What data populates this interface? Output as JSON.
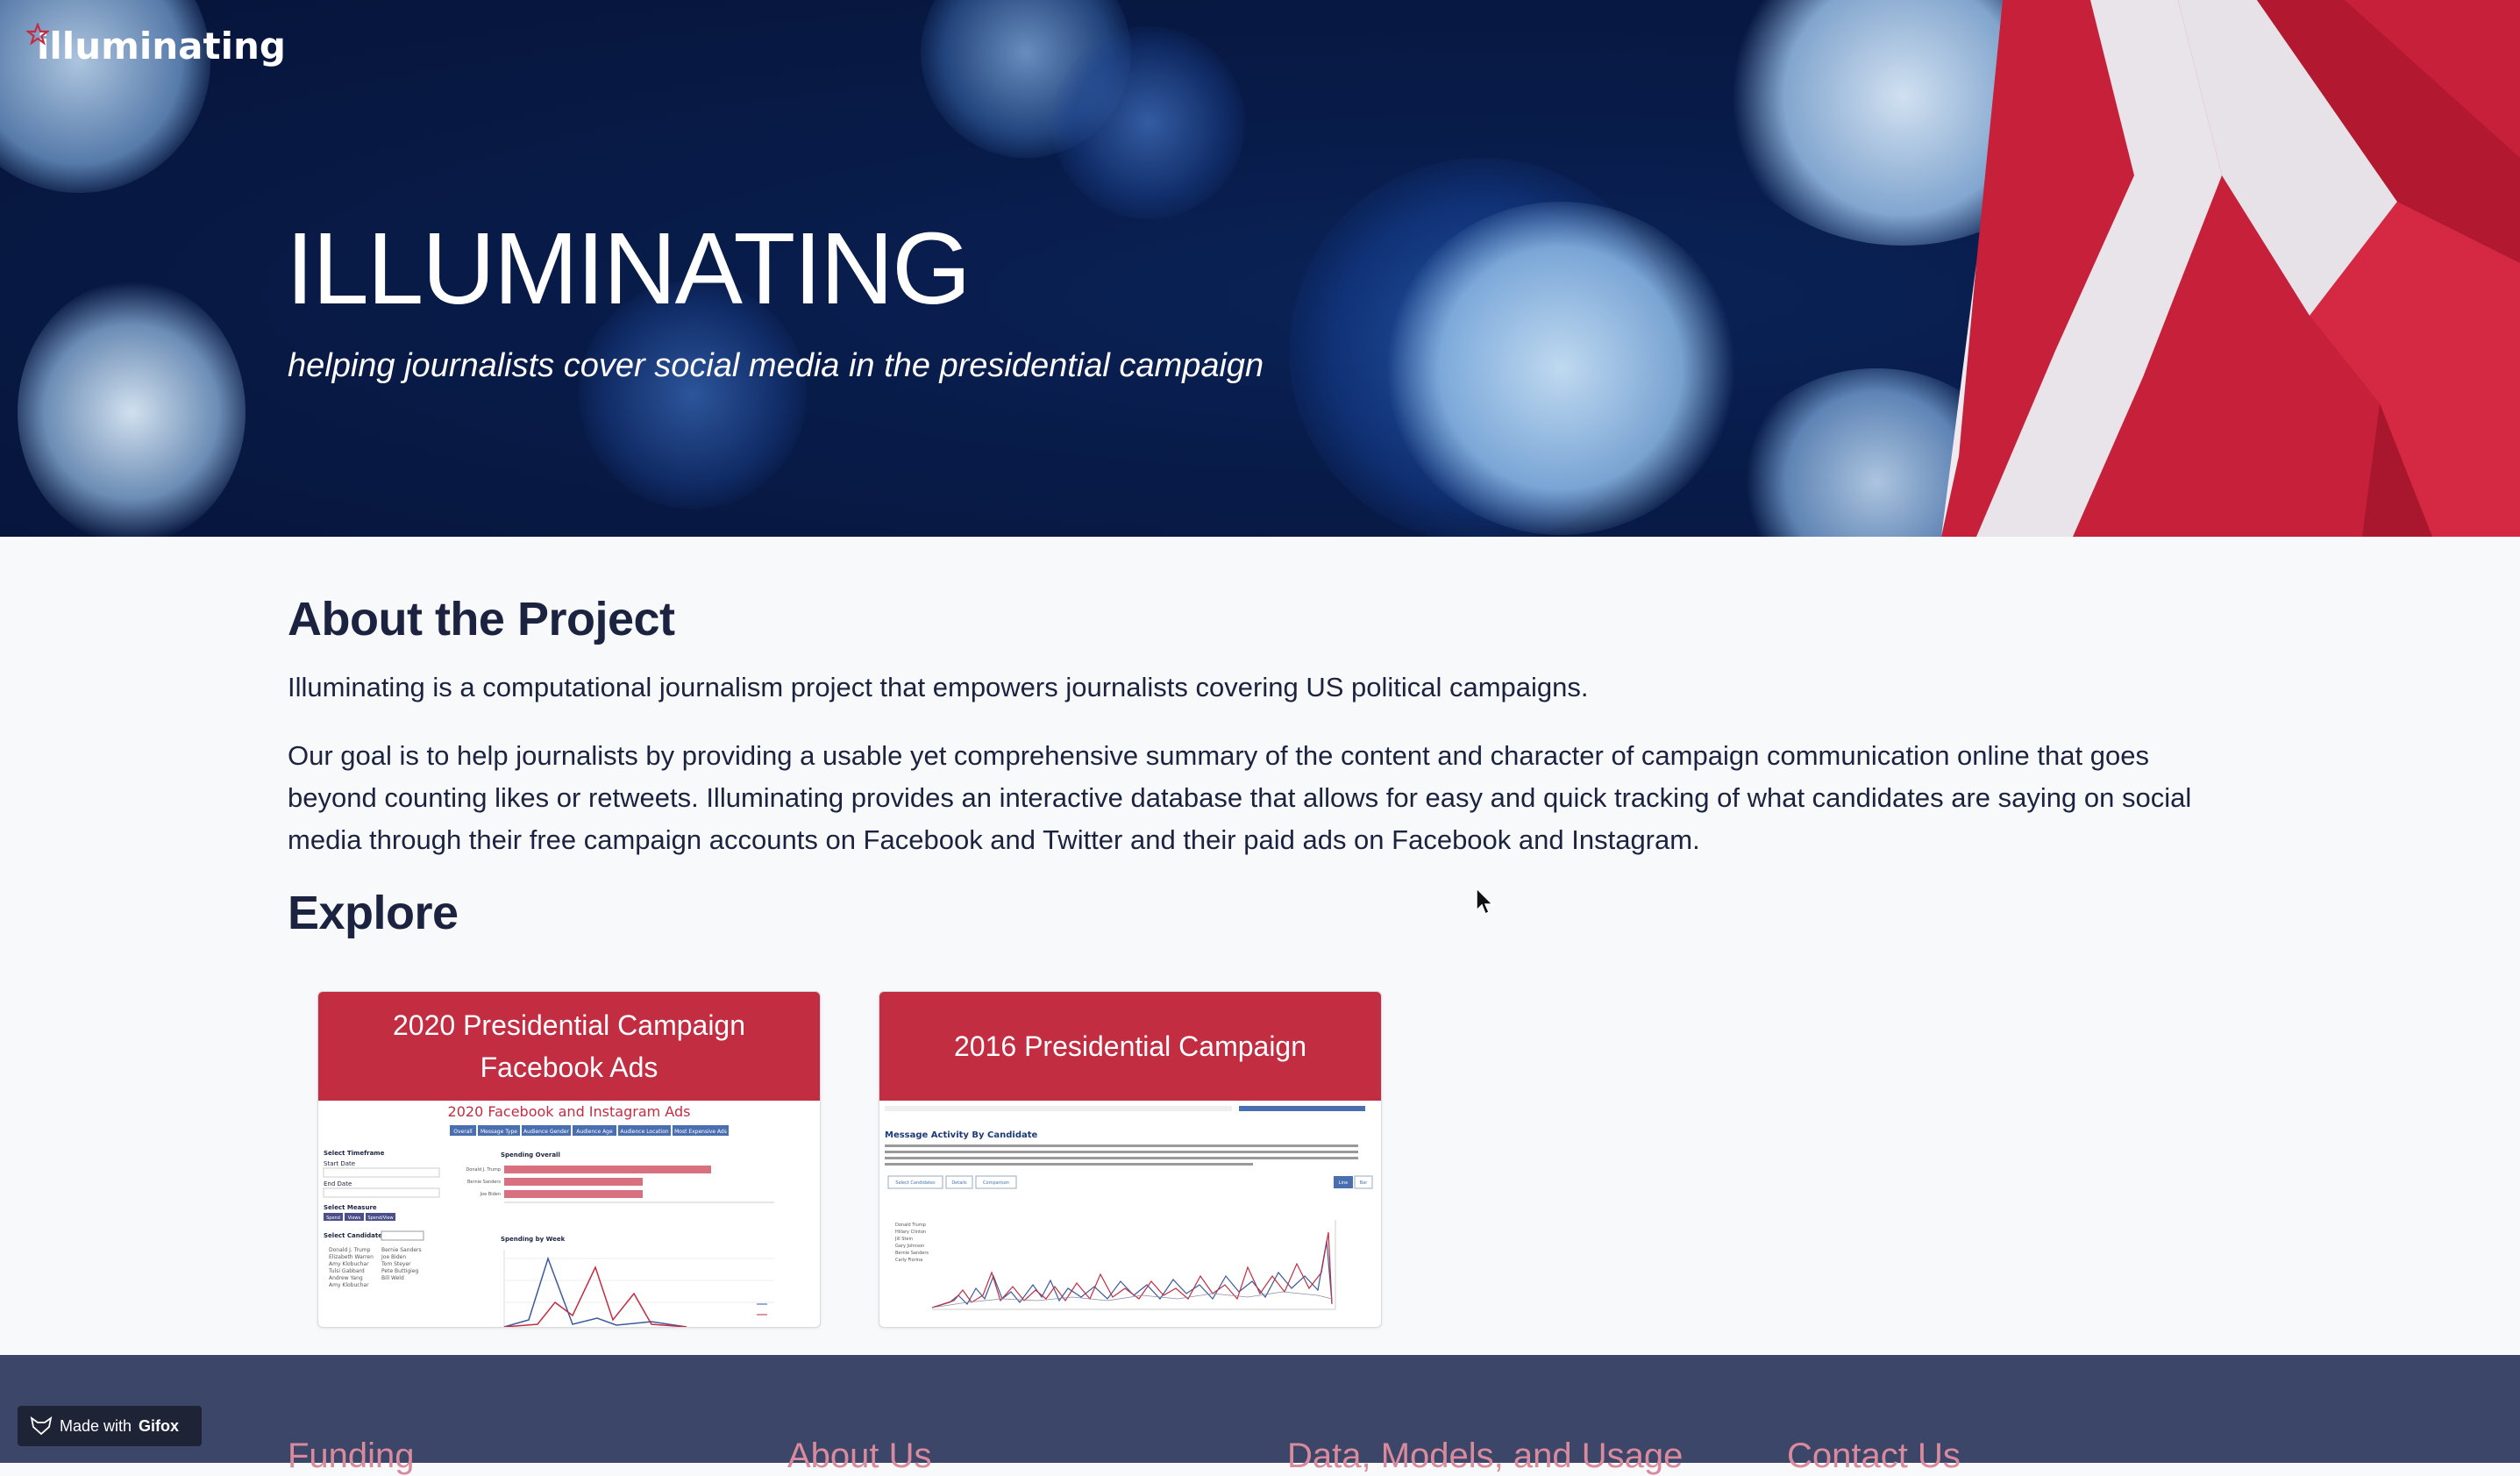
{
  "brand": {
    "logo_text": "illuminating"
  },
  "hero": {
    "title": "ILLUMINATING",
    "subtitle": "helping journalists cover social media in the presidential campaign"
  },
  "about": {
    "title": "About the Project",
    "p1": "Illuminating is a computational journalism project that empowers journalists covering US political campaigns.",
    "p2": "Our goal is to help journalists by providing a usable yet comprehensive summary of the content and character of campaign communication online that goes beyond counting likes or retweets. Illuminating provides an interactive database that allows for easy and quick tracking of what candidates are saying on social media through their free campaign accounts on Facebook and Twitter and their paid ads on Facebook and Instagram."
  },
  "explore": {
    "title": "Explore",
    "cards": [
      {
        "title": "2020 Presidential Campaign Facebook Ads",
        "preview": {
          "heading": "2020 Facebook and Instagram Ads",
          "tabs": [
            "Overall",
            "Message Type",
            "Audience Gender",
            "Audience Age",
            "Audience Location",
            "Most Expensive Ads"
          ],
          "left_labels": [
            "Select Timeframe",
            "Start Date",
            "End Date",
            "Select Measure",
            "Select Candidates"
          ],
          "measure_buttons": [
            "Spend",
            "Views",
            "Spend/View"
          ],
          "candidates_col1": [
            "Donald J. Trump",
            "Elizabeth Warren",
            "Amy Klobuchar",
            "Tulsi Gabbard",
            "Andrew Yang",
            "Amy Klobuchar"
          ],
          "candidates_col2": [
            "Bernie Sanders",
            "Joe Biden",
            "Tom Steyer",
            "Pete Buttigieg",
            "Bill Weld"
          ],
          "chart1_title": "Spending Overall",
          "chart1_bars": [
            "Donald J. Trump",
            "Bernie Sanders",
            "Joe Biden"
          ],
          "chart1_values": [
            1.0,
            0.67,
            0.67
          ],
          "chart2_title": "Spending by Week"
        }
      },
      {
        "title": "2016 Presidential Campaign",
        "preview": {
          "heading": "Message Activity By Candidate",
          "buttons": [
            "Select Candidates",
            "Details",
            "Comparison"
          ],
          "toggles": [
            "Line",
            "Bar"
          ],
          "legend": [
            "Donald Trump",
            "Hillary Clinton",
            "Jill Stein",
            "Gary Johnson",
            "Bernie Sanders",
            "Carly Fiorina"
          ]
        }
      }
    ]
  },
  "footer": {
    "columns": [
      "Funding",
      "About Us",
      "Data, Models, and Usage",
      "Contact Us"
    ],
    "badge_prefix": "Made with",
    "badge_brand": "Gifox"
  },
  "colors": {
    "accent": "#c22d42",
    "footer_bg": "#3c4668",
    "hero_bg": "#081b48"
  }
}
